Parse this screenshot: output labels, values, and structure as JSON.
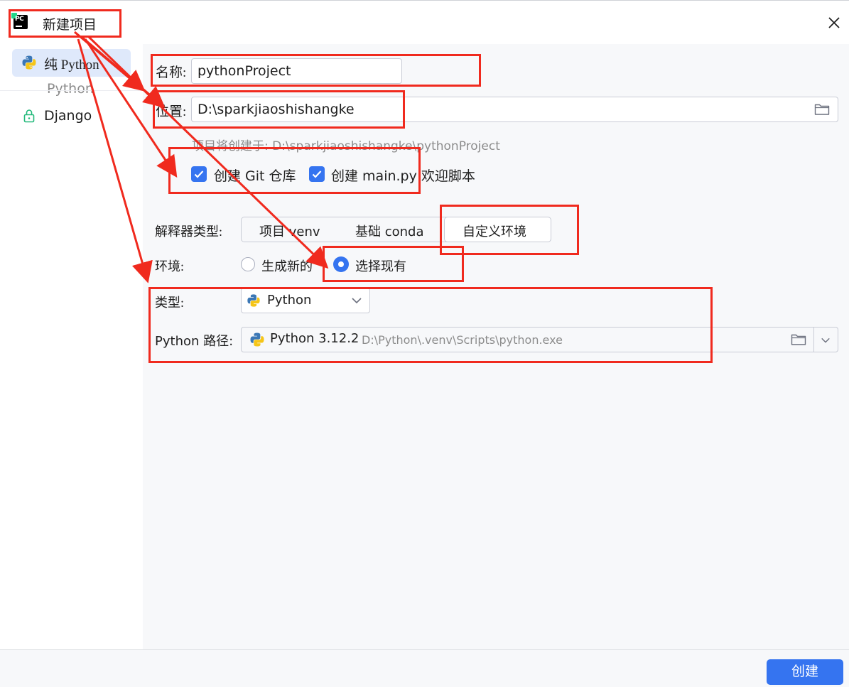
{
  "window": {
    "title": "新建项目",
    "close_icon": "close-icon"
  },
  "sidebar": {
    "items": [
      {
        "label": "纯 Python",
        "icon": "python-icon",
        "selected": true
      },
      {
        "label": "Python",
        "section": true
      },
      {
        "label": "Django",
        "icon": "lock-icon"
      }
    ]
  },
  "form": {
    "name_label": "名称:",
    "name_value": "pythonProject",
    "location_label": "位置:",
    "location_value": "D:\\sparkjiaoshishangke",
    "create_hint": "项目将创建于: D:\\sparkjiaoshishangke\\pythonProject",
    "git_checkbox_label": "创建 Git 仓库",
    "git_checked": true,
    "main_checkbox_label": "创建 main.py 欢迎脚本",
    "main_checked": true,
    "interpreter_type_label": "解释器类型:",
    "interpreter_types": [
      "项目 venv",
      "基础 conda",
      "自定义环境"
    ],
    "interpreter_selected": "自定义环境",
    "env_label": "环境:",
    "env_options": [
      "生成新的",
      "选择现有"
    ],
    "env_selected": "选择现有",
    "type_label": "类型:",
    "type_value": "Python",
    "python_path_label": "Python 路径:",
    "python_path_version": "Python 3.12.2",
    "python_path_value": "D:\\Python\\.venv\\Scripts\\python.exe"
  },
  "footer": {
    "create_button": "创建"
  },
  "colors": {
    "accent": "#3574f0",
    "annotation": "#f02a1e",
    "selected_bg": "#dfe9fb"
  }
}
